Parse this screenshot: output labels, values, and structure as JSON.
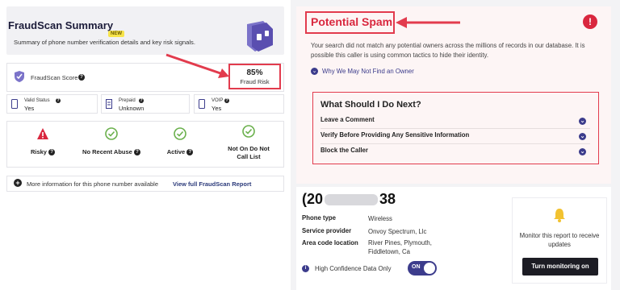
{
  "left": {
    "summary": {
      "title": "FraudScan Summary",
      "badge": "NEW",
      "subtitle": "Summary of phone number verification details and key risk signals."
    },
    "score": {
      "label": "FraudScan Score",
      "info": "?",
      "percent": "85%",
      "risk_label": "Fraud Risk"
    },
    "mini_cards": [
      {
        "label": "Valid Status",
        "value": "Yes",
        "icon": "phone-icon"
      },
      {
        "label": "Prepaid",
        "value": "Unknown",
        "icon": "receipt-icon"
      },
      {
        "label": "VOIP",
        "value": "Yes",
        "icon": "phone-icon"
      }
    ],
    "signals": [
      {
        "label": "Risky",
        "icon": "warning-triangle-icon",
        "color": "#d9273e"
      },
      {
        "label": "No Recent Abuse",
        "icon": "check-circle-icon",
        "color": "#6ab04c"
      },
      {
        "label": "Active",
        "icon": "check-circle-icon",
        "color": "#6ab04c"
      },
      {
        "label_line1": "Not On Do Not",
        "label_line2": "Call List",
        "icon": "check-circle-icon",
        "color": "#6ab04c"
      }
    ],
    "more_info": {
      "text": "More information for this phone number available",
      "link": "View full FraudScan Report"
    }
  },
  "right": {
    "spam": {
      "title": "Potential Spam",
      "alert": "!",
      "description": "Your search did not match any potential owners across the millions of records in our database. It is possible this caller is using common tactics to hide their identity.",
      "why_link": "Why We May Not Find an Owner"
    },
    "next": {
      "title": "What Should I Do Next?",
      "items": [
        "Leave a Comment",
        "Verify Before Providing Any Sensitive Information",
        "Block the Caller"
      ]
    },
    "details": {
      "phone_prefix": "(20",
      "phone_suffix": "38",
      "rows": [
        {
          "label": "Phone type",
          "value": "Wireless"
        },
        {
          "label": "Service provider",
          "value": "Onvoy Spectrum, Llc"
        },
        {
          "label": "Area code location",
          "value_line1": "River Pines, Plymouth,",
          "value_line2": "Fiddletown, Ca"
        }
      ],
      "high_confidence": "High Confidence Data Only",
      "toggle_state": "ON"
    },
    "monitor": {
      "text": "Monitor this report to receive updates",
      "button": "Turn monitoring on"
    }
  },
  "colors": {
    "accent_red": "#e23b4d",
    "brand_purple": "#3c3c8c",
    "ok_green": "#6ab04c"
  }
}
